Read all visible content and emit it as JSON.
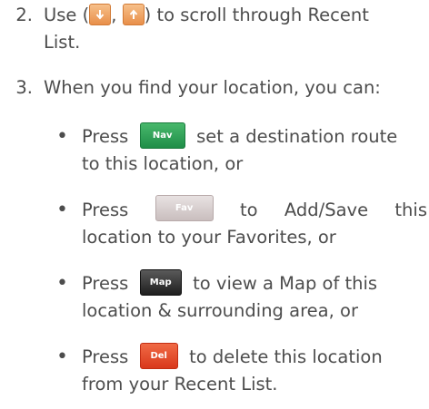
{
  "steps": [
    {
      "number": "2.",
      "line1_before": "Use (",
      "line1_sep": ",",
      "line1_after": ") to scroll through Recent",
      "line2": "List."
    },
    {
      "number": "3.",
      "text": "When you find your location, you can:"
    }
  ],
  "icons": {
    "scroll_down": "down-arrow-icon",
    "scroll_up": "up-arrow-icon"
  },
  "bullets": [
    {
      "press": "Press",
      "button": "Nav",
      "line1_after": "set a destination route",
      "line2": "to this location, or"
    },
    {
      "press": "Press",
      "button": "Fav",
      "line1_words": [
        "to",
        "Add/Save",
        "this"
      ],
      "line2": "location to your Favorites, or"
    },
    {
      "press": "Press",
      "button": "Map",
      "line1_after": "to view a Map of this",
      "line2": "location & surrounding area, or"
    },
    {
      "press": "Press",
      "button": "Del",
      "line1_after": "to delete this location",
      "line2": "from your Recent List."
    }
  ],
  "bullet_symbol": "•",
  "colors": {
    "text": "#4d4d4d",
    "nav": "#2ea154",
    "fav": "#d8cfcf",
    "map": "#333333",
    "del": "#e5512f",
    "arrow": "#f0a465"
  }
}
